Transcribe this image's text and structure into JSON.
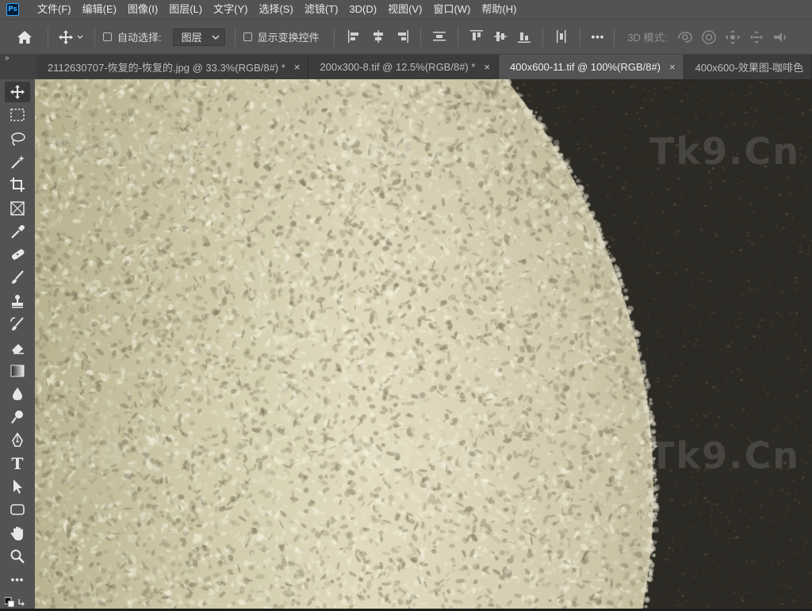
{
  "app": {
    "logo": "Ps"
  },
  "menu": [
    "文件(F)",
    "编辑(E)",
    "图像(I)",
    "图层(L)",
    "文字(Y)",
    "选择(S)",
    "滤镜(T)",
    "3D(D)",
    "视图(V)",
    "窗口(W)",
    "帮助(H)"
  ],
  "options": {
    "auto_select_label": "自动选择:",
    "auto_select_checked": false,
    "layer_select_value": "图层",
    "show_transform_label": "显示变换控件",
    "show_transform_checked": false,
    "more_label": "•••",
    "mode3d_label": "3D 模式:"
  },
  "tabs": [
    {
      "label": "2112630707-恢复的-恢复的.jpg @ 33.3%(RGB/8#) *",
      "close": "×",
      "active": false
    },
    {
      "label": "200x300-8.tif @ 12.5%(RGB/8#) *",
      "close": "×",
      "active": false
    },
    {
      "label": "400x600-11.tif @ 100%(RGB/8#)",
      "close": "×",
      "active": true
    },
    {
      "label": "400x600-效果图-咖啡色",
      "close": "",
      "active": false
    }
  ],
  "toolbar": {
    "collapse": "»",
    "active_tool": "move-tool",
    "tools": [
      "move-tool",
      "marquee-tool",
      "lasso-tool",
      "magic-wand-tool",
      "crop-tool",
      "frame-tool",
      "eyedropper-tool",
      "healing-brush-tool",
      "brush-tool",
      "clone-stamp-tool",
      "history-brush-tool",
      "eraser-tool",
      "gradient-tool",
      "blur-tool",
      "dodge-tool",
      "pen-tool",
      "type-tool",
      "path-selection-tool",
      "rectangle-tool",
      "hand-tool",
      "zoom-tool",
      "more-tools"
    ],
    "type_tool_glyph": "T",
    "more_glyph": "•••"
  },
  "watermarks": [
    "Tk9.Cn",
    "Tk9.Cn",
    "Tk9.Cn",
    "Tk9.Cn",
    "Tk9.Cn",
    "Tk9.Cn"
  ],
  "colors": {
    "panel": "#535353",
    "tab_inactive": "#3c3c3c",
    "canvas_dark": "#2c2a24",
    "canvas_light": "#d8d1b4"
  }
}
